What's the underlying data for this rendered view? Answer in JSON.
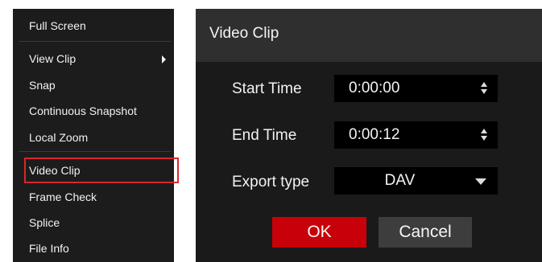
{
  "context_menu": {
    "items": [
      {
        "label": "Full Screen"
      },
      {
        "label": "View Clip",
        "has_submenu": true
      },
      {
        "label": "Snap"
      },
      {
        "label": "Continuous Snapshot"
      },
      {
        "label": "Local Zoom"
      },
      {
        "label": "Video Clip",
        "highlighted": true
      },
      {
        "label": "Frame Check"
      },
      {
        "label": "Splice"
      },
      {
        "label": "File Info"
      }
    ],
    "highlight_color": "#d8262c"
  },
  "dialog": {
    "title": "Video Clip",
    "start_time": {
      "label": "Start Time",
      "value": "0:00:00",
      "icon": "spinner-arrows-icon"
    },
    "end_time": {
      "label": "End Time",
      "value": "0:00:12",
      "icon": "spinner-arrows-icon"
    },
    "export_type": {
      "label": "Export type",
      "value": "DAV",
      "icon": "dropdown-caret-icon"
    },
    "ok_label": "OK",
    "cancel_label": "Cancel",
    "ok_color": "#c8000a"
  }
}
